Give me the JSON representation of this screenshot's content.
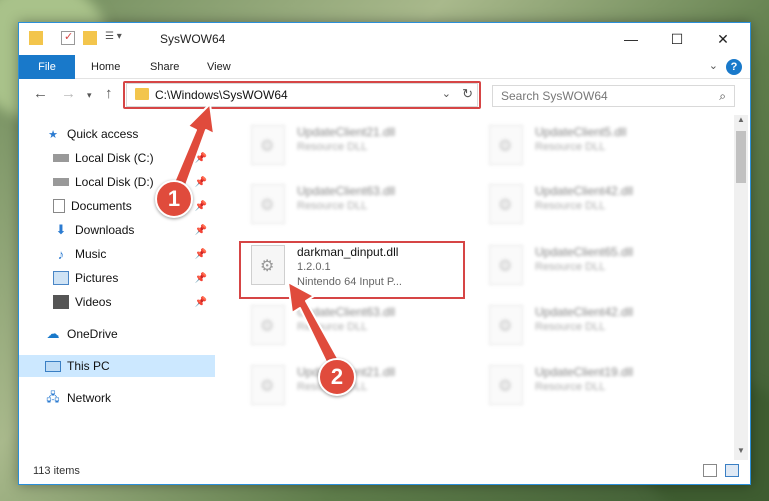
{
  "window": {
    "title": "SysWOW64",
    "controls": {
      "minimize": "—",
      "maximize": "☐",
      "close": "✕"
    }
  },
  "ribbon": {
    "tabs": [
      "File",
      "Home",
      "Share",
      "View"
    ],
    "help": "?"
  },
  "address": {
    "path": "C:\\Windows\\SysWOW64",
    "search_placeholder": "Search SysWOW64"
  },
  "nav": {
    "items": [
      {
        "label": "Quick access",
        "icon": "star-icon",
        "pinned": false
      },
      {
        "label": "Local Disk (C:)",
        "icon": "drive-icon",
        "pinned": true
      },
      {
        "label": "Local Disk (D:)",
        "icon": "drive-icon",
        "pinned": true
      },
      {
        "label": "Documents",
        "icon": "documents-icon",
        "pinned": true
      },
      {
        "label": "Downloads",
        "icon": "download-icon",
        "pinned": true
      },
      {
        "label": "Music",
        "icon": "music-icon",
        "pinned": true
      },
      {
        "label": "Pictures",
        "icon": "pictures-icon",
        "pinned": true
      },
      {
        "label": "Videos",
        "icon": "videos-icon",
        "pinned": true
      },
      {
        "label": "OneDrive",
        "icon": "cloud-icon",
        "pinned": false
      },
      {
        "label": "This PC",
        "icon": "computer-icon",
        "pinned": false
      },
      {
        "label": "Network",
        "icon": "network-icon",
        "pinned": false
      }
    ]
  },
  "files": {
    "left": [
      {
        "name": "UpdateClient21.dll",
        "type": "Resource DLL"
      },
      {
        "name": "UpdateClient63.dll",
        "type": "Resource DLL"
      },
      {
        "name": "darkman_dinput.dll",
        "version": "1.2.0.1",
        "desc": "Nintendo 64 Input P..."
      },
      {
        "name": "UpdateClient63.dll",
        "type": "Resource DLL"
      },
      {
        "name": "UpdateClient21.dll",
        "type": "Resource DLL"
      }
    ],
    "right": [
      {
        "name": "UpdateClient5.dll",
        "type": "Resource DLL"
      },
      {
        "name": "UpdateClient42.dll",
        "type": "Resource DLL"
      },
      {
        "name": "UpdateClient65.dll",
        "type": "Resource DLL"
      },
      {
        "name": "UpdateClient42.dll",
        "type": "Resource DLL"
      },
      {
        "name": "UpdateClient19.dll",
        "type": "Resource DLL"
      }
    ]
  },
  "status": {
    "items": "113 items"
  },
  "annotations": {
    "step1": "1",
    "step2": "2"
  },
  "colors": {
    "accent": "#1979ca",
    "highlight": "#d64545",
    "badge": "#e04b3c"
  }
}
